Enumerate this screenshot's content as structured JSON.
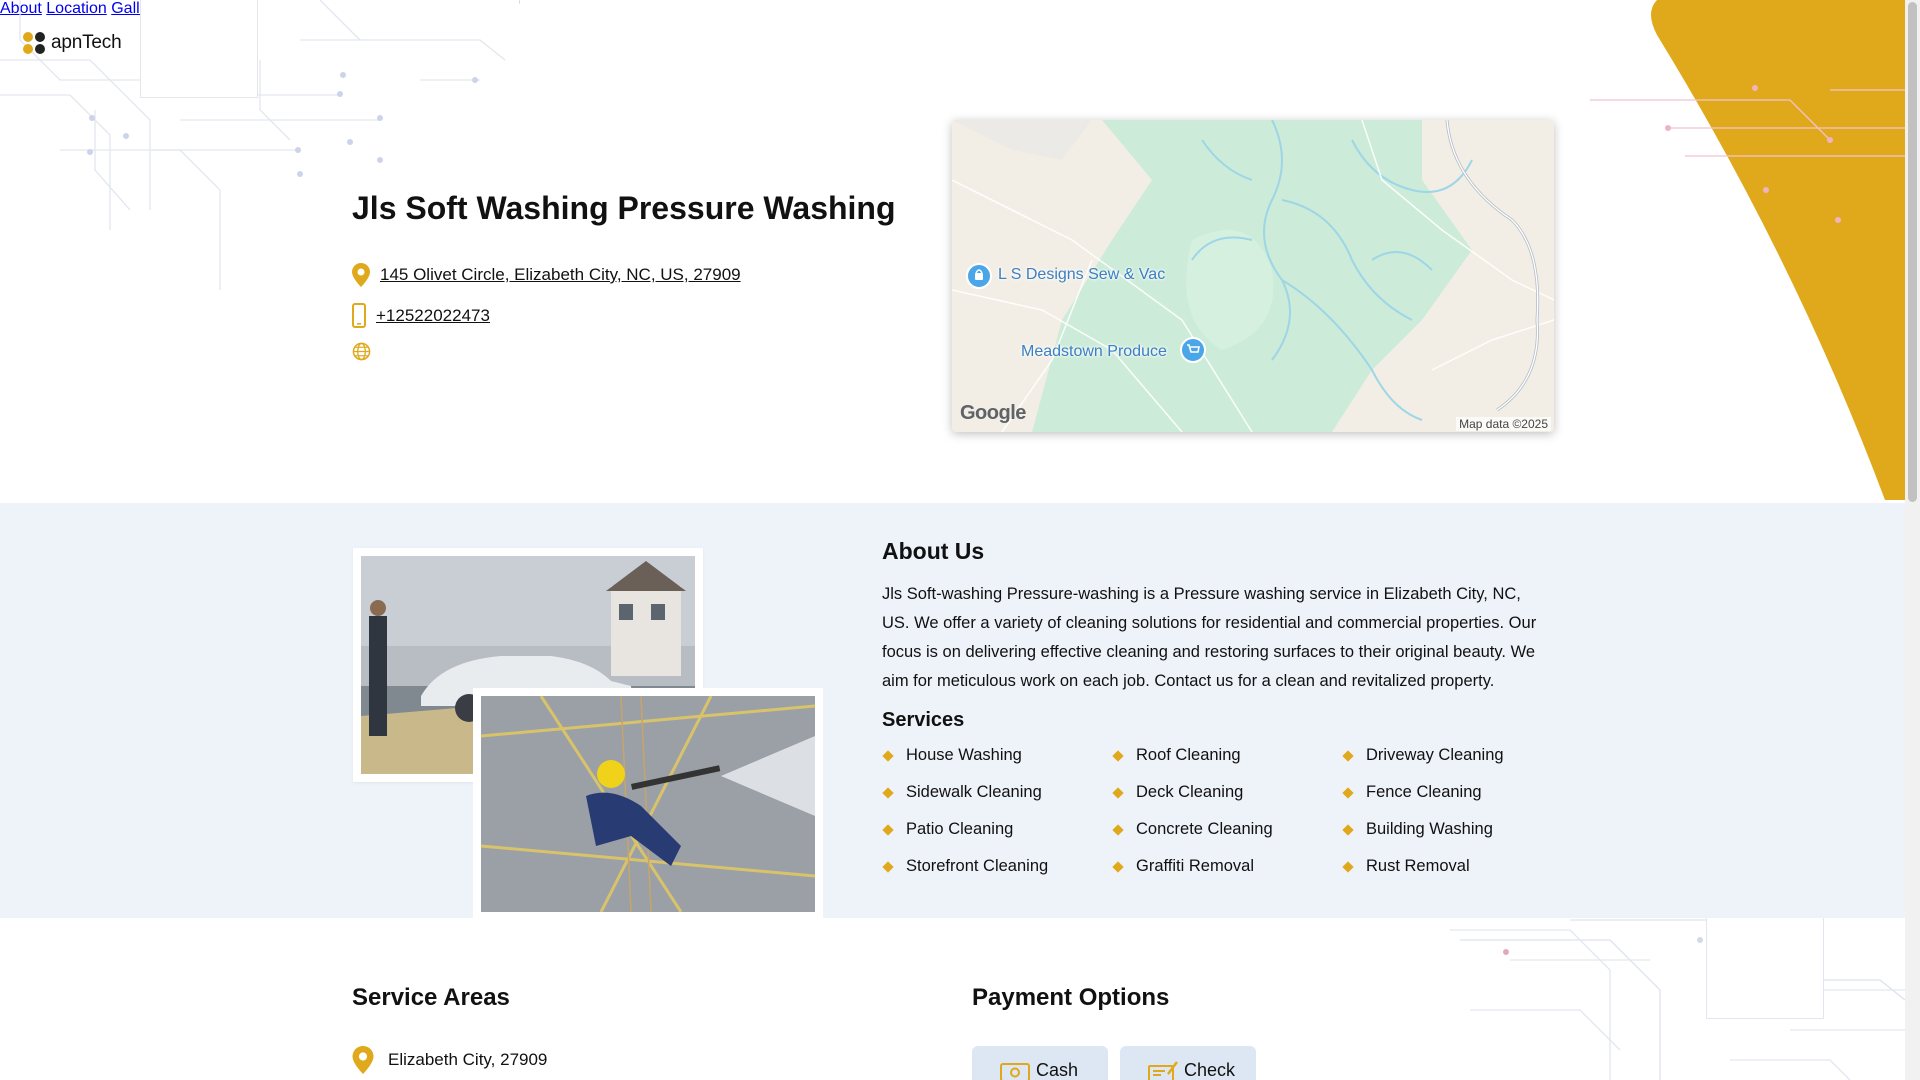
{
  "header": {
    "logo_text": "apnTech",
    "nav": [
      {
        "label": "About"
      },
      {
        "label": "Location"
      },
      {
        "label": "Gallery"
      }
    ]
  },
  "business": {
    "name": "Jls Soft Washing Pressure Washing",
    "address": "145 Olivet Circle, Elizabeth City, NC, US, 27909",
    "phone": "+12522022473",
    "icons": {
      "address": "map-pin-icon",
      "phone": "phone-icon",
      "website": "globe-icon"
    }
  },
  "map": {
    "places": [
      {
        "name": "L S Designs Sew & Vac"
      },
      {
        "name": "Meadstown Produce"
      }
    ],
    "brand": "Google",
    "attribution": "Map data ©2025"
  },
  "about": {
    "title": "About Us",
    "text": "Jls Soft-washing Pressure-washing is a Pressure washing service in Elizabeth City, NC, US. We offer a variety of cleaning solutions for residential and commercial properties. Our focus is on delivering effective cleaning and restoring surfaces to their original beauty. We aim for meticulous work on each job. Contact us for a clean and revitalized property.",
    "services_title": "Services",
    "services": [
      "House Washing",
      "Roof Cleaning",
      "Driveway Cleaning",
      "Sidewalk Cleaning",
      "Deck Cleaning",
      "Fence Cleaning",
      "Patio Cleaning",
      "Concrete Cleaning",
      "Building Washing",
      "Storefront Cleaning",
      "Graffiti Removal",
      "Rust Removal"
    ]
  },
  "service_areas": {
    "title": "Service Areas",
    "items": [
      "Elizabeth City, 27909"
    ]
  },
  "payment": {
    "title": "Payment Options",
    "options": [
      {
        "label": "Cash",
        "icon": "cash-icon"
      },
      {
        "label": "Check",
        "icon": "check-icon"
      }
    ]
  },
  "colors": {
    "accent": "#e0a91b",
    "band": "#eef2f9",
    "pay_button": "#dde6f3"
  }
}
